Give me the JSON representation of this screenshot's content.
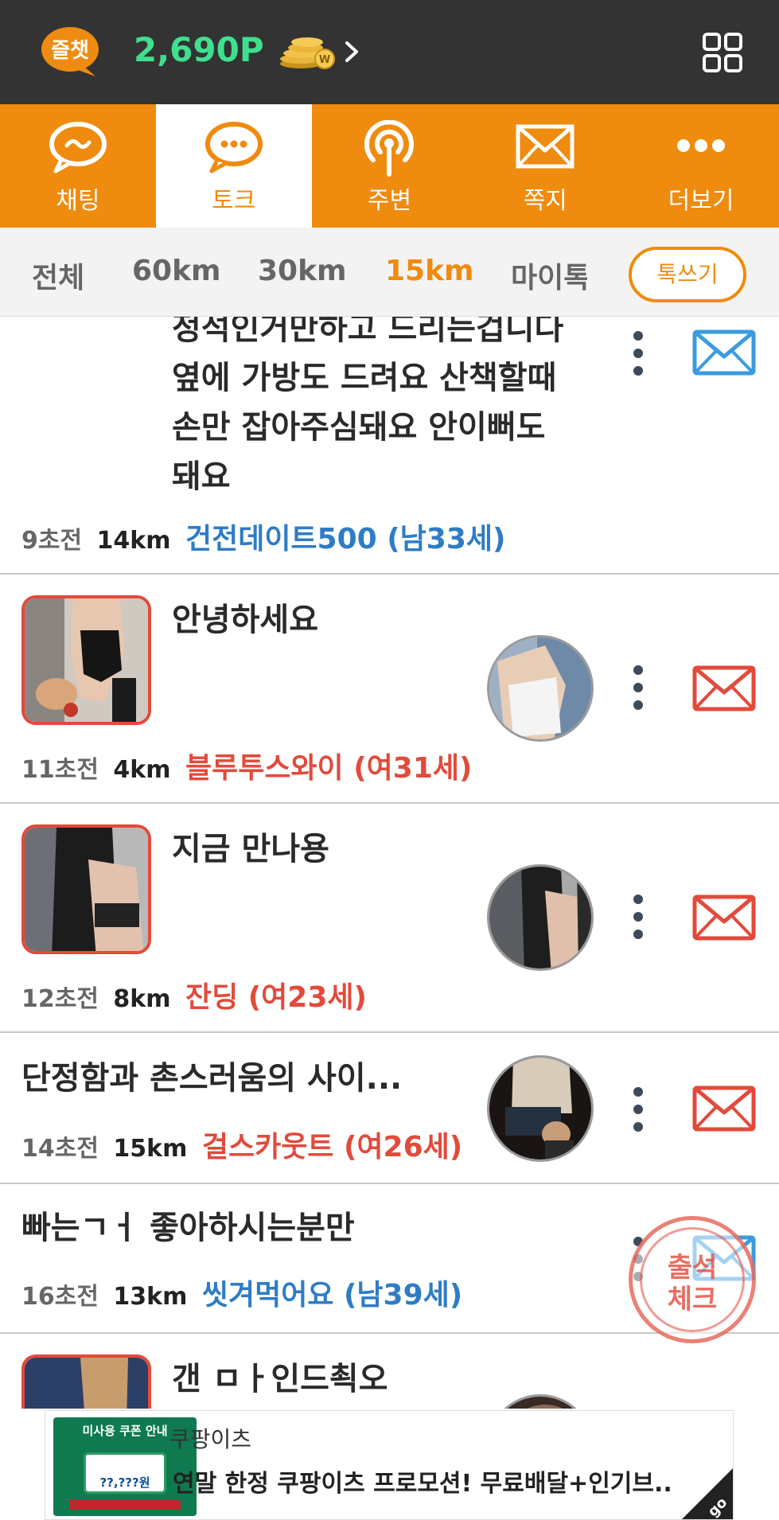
{
  "topbar": {
    "app_logo_text": "즐챗",
    "points": "2,690P"
  },
  "nav": {
    "tabs": [
      {
        "label": "채팅",
        "icon": "chat-tilde-icon"
      },
      {
        "label": "토크",
        "icon": "chat-dots-icon",
        "active": true
      },
      {
        "label": "주변",
        "icon": "broadcast-icon"
      },
      {
        "label": "쪽지",
        "icon": "envelope-icon"
      },
      {
        "label": "더보기",
        "icon": "more-dots-icon"
      }
    ]
  },
  "filter": {
    "items": [
      "전체",
      "60km",
      "30km",
      "15km",
      "마이톡"
    ],
    "active": "15km",
    "write_button": "톡쓰기"
  },
  "posts": [
    {
      "message_lines": [
        "정석인거만하고 드리는겁니다",
        "옆에 가방도 드려요 산책할때",
        "손만 잡아주심돼요 안이뻐도",
        "돼요"
      ],
      "time": "9초전",
      "distance": "14km",
      "nickname": "건전데이트500 (남33세)",
      "gender": "male"
    },
    {
      "message": "안녕하세요",
      "time": "11초전",
      "distance": "4km",
      "nickname": "블루투스와이 (여31세)",
      "gender": "female"
    },
    {
      "message": "지금 만나용",
      "time": "12초전",
      "distance": "8km",
      "nickname": "잔딩 (여23세)",
      "gender": "female"
    },
    {
      "message": "단정함과 촌스러움의 사이...",
      "time": "14초전",
      "distance": "15km",
      "nickname": "걸스카웃트 (여26세)",
      "gender": "female"
    },
    {
      "message": "빠는ㄱㅓ 좋아하시는분만",
      "time": "16초전",
      "distance": "13km",
      "nickname": "씻겨먹어요 (남39세)",
      "gender": "male"
    },
    {
      "message": "갠 ㅁㅏ인드쵝오"
    }
  ],
  "stamp": {
    "line1": "출석",
    "line2": "체크"
  },
  "ad": {
    "image_title": "미사용 쿠폰 안내",
    "image_price": "??,???원",
    "brand": "쿠팡이츠",
    "text": "연말 한정 쿠팡이츠 프로모션! 무료배달+인기브..",
    "corner_label": "go"
  },
  "colors": {
    "topbar": "#333333",
    "accent": "#ef8b0e",
    "points": "#3ee08f",
    "male": "#2e7cc6",
    "female": "#e24a3b"
  }
}
